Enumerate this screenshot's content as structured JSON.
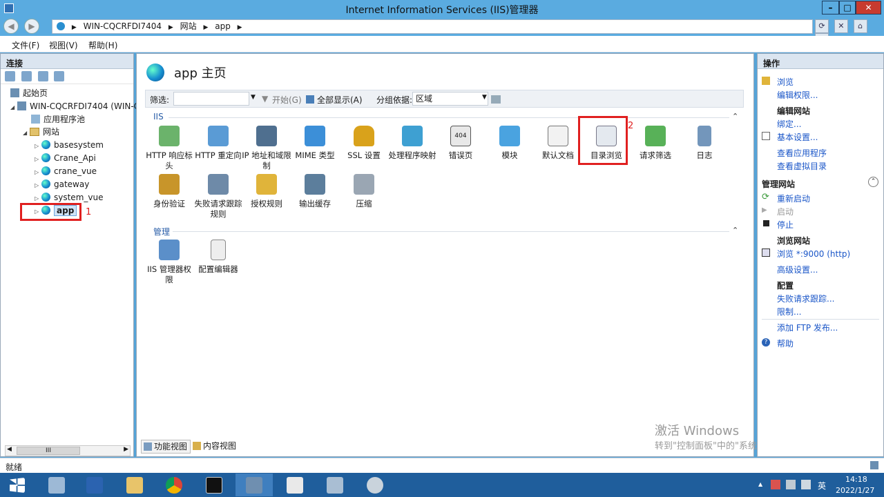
{
  "window": {
    "title": "Internet Information Services (IIS)管理器"
  },
  "nav": {
    "crumbs": [
      "WIN-CQCRFDI7404",
      "网站",
      "app"
    ]
  },
  "menu": [
    "文件(F)",
    "视图(V)",
    "帮助(H)"
  ],
  "connections": {
    "header": "连接",
    "tree": [
      {
        "label": "起始页"
      },
      {
        "label": "WIN-CQCRFDI7404 (WIN-C"
      },
      {
        "label": "应用程序池"
      },
      {
        "label": "网站"
      },
      {
        "label": "basesystem"
      },
      {
        "label": "Crane_Api"
      },
      {
        "label": "crane_vue"
      },
      {
        "label": "gateway"
      },
      {
        "label": "system_vue"
      },
      {
        "label": "app"
      }
    ],
    "mark1": "1",
    "scroll_label": "III"
  },
  "center": {
    "title": "app 主页",
    "filter": {
      "label": "筛选:",
      "start": "开始(G)",
      "show_all": "全部显示(A)",
      "group_by": "分组依据:",
      "group_value": "区域"
    },
    "sections": [
      {
        "name": "IIS"
      },
      {
        "name": "管理"
      }
    ],
    "features": [
      {
        "label": "HTTP 响应标头"
      },
      {
        "label": "HTTP 重定向"
      },
      {
        "label": "IP 地址和域限制"
      },
      {
        "label": "MIME 类型"
      },
      {
        "label": "SSL 设置"
      },
      {
        "label": "处理程序映射"
      },
      {
        "label": "错误页"
      },
      {
        "label": "模块"
      },
      {
        "label": "默认文档"
      },
      {
        "label": "目录浏览"
      },
      {
        "label": "请求筛选"
      },
      {
        "label": "日志"
      },
      {
        "label": "身份验证"
      },
      {
        "label": "失败请求跟踪规则"
      },
      {
        "label": "授权规则"
      },
      {
        "label": "输出缓存"
      },
      {
        "label": "压缩"
      }
    ],
    "manage_features": [
      {
        "label": "IIS 管理器权限"
      },
      {
        "label": "配置编辑器"
      }
    ],
    "mark2": "2",
    "view_tabs": [
      "功能视图",
      "内容视图"
    ],
    "watermark": {
      "line1": "激活 Windows",
      "line2": "转到\"控制面板\"中的\"系统\"以激活 Windows。"
    }
  },
  "actions": {
    "header": "操作",
    "items": [
      {
        "label": "浏览",
        "kind": "link"
      },
      {
        "label": "编辑权限...",
        "kind": "link"
      },
      {
        "label": "编辑网站",
        "kind": "header"
      },
      {
        "label": "绑定...",
        "kind": "link"
      },
      {
        "label": "基本设置...",
        "kind": "link"
      },
      {
        "label": "查看应用程序",
        "kind": "link"
      },
      {
        "label": "查看虚拟目录",
        "kind": "link"
      },
      {
        "label": "管理网站",
        "kind": "header"
      },
      {
        "label": "重新启动",
        "kind": "link"
      },
      {
        "label": "启动",
        "kind": "disabled"
      },
      {
        "label": "停止",
        "kind": "link"
      },
      {
        "label": "浏览网站",
        "kind": "header"
      },
      {
        "label": "浏览 *:9000 (http)",
        "kind": "link"
      },
      {
        "label": "高级设置...",
        "kind": "link"
      },
      {
        "label": "配置",
        "kind": "header"
      },
      {
        "label": "失败请求跟踪...",
        "kind": "link"
      },
      {
        "label": "限制...",
        "kind": "link"
      },
      {
        "label": "添加 FTP 发布...",
        "kind": "link"
      },
      {
        "label": "帮助",
        "kind": "link"
      }
    ]
  },
  "status": {
    "text": "就绪"
  },
  "taskbar": {
    "apps": [
      "start-icon",
      "server-manager-icon",
      "powershell-icon",
      "file-explorer-icon",
      "chrome-icon",
      "cmd-icon",
      "iis-icon",
      "java-icon",
      "network-icon",
      "settings-icon"
    ],
    "lang": "英",
    "time": "14:18",
    "date": "2022/1/27"
  }
}
